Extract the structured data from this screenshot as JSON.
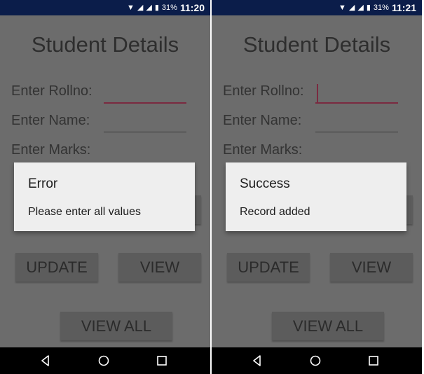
{
  "screens": [
    {
      "status": {
        "battery": "31%",
        "time": "11:20"
      },
      "title": "Student Details",
      "form": {
        "rollno_label": "Enter Rollno:",
        "name_label": "Enter Name:",
        "marks_label": "Enter Marks:",
        "rollno_value": "",
        "name_value": ""
      },
      "buttons": {
        "update": "UPDATE",
        "view": "VIEW",
        "view_all": "VIEW ALL"
      },
      "dialog": {
        "title": "Error",
        "message": "Please enter all values"
      }
    },
    {
      "status": {
        "battery": "31%",
        "time": "11:21"
      },
      "title": "Student Details",
      "form": {
        "rollno_label": "Enter Rollno:",
        "name_label": "Enter Name:",
        "marks_label": "Enter Marks:",
        "rollno_value": "",
        "name_value": ""
      },
      "buttons": {
        "update": "UPDATE",
        "view": "VIEW",
        "view_all": "VIEW ALL"
      },
      "dialog": {
        "title": "Success",
        "message": "Record added"
      }
    }
  ],
  "icons": {
    "wifi": "wifi-icon",
    "signal": "signal-icon",
    "battery": "battery-icon",
    "back": "back-icon",
    "home": "home-icon",
    "recent": "recent-apps-icon"
  },
  "colors": {
    "status_bar": "#0b1d4a",
    "dimmed_background": "#6c6c6c",
    "dialog_background": "#eeeeee",
    "accent": "#7a2a40"
  }
}
